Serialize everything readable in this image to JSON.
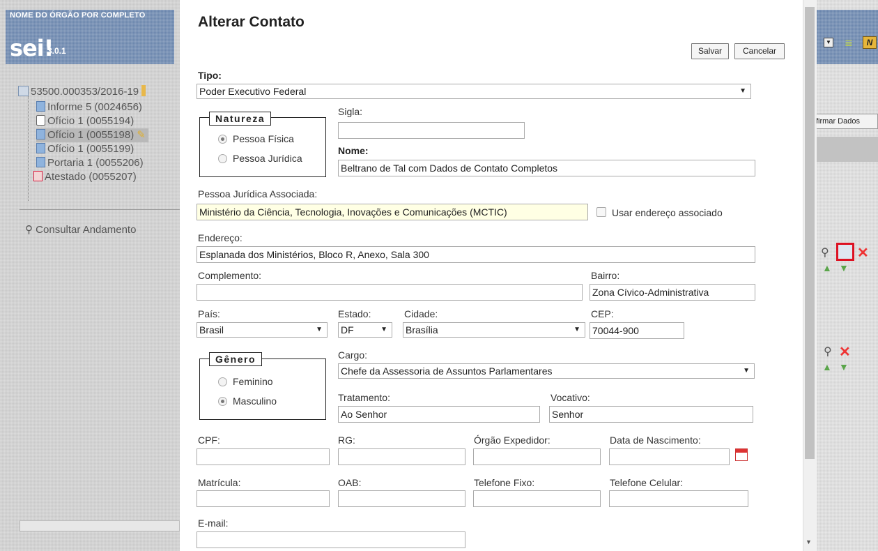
{
  "sidebar": {
    "org_name": "NOME DO ÓRGÃO POR COMPLETO",
    "logo": "sei!",
    "version": "3.0.1",
    "process_number": "53500.000353/2016-19",
    "documents": [
      {
        "label": "Informe 5 (0024656)"
      },
      {
        "label": "Ofício 1 (0055194)"
      },
      {
        "label": "Ofício 1 (0055198)"
      },
      {
        "label": "Ofício 1 (0055199)"
      },
      {
        "label": "Portaria 1 (0055206)"
      },
      {
        "label": "Atestado (0055207)"
      }
    ],
    "consultar": "Consultar Andamento"
  },
  "background": {
    "confirm_button": "firmar Dados"
  },
  "form": {
    "title": "Alterar Contato",
    "save_label": "Salvar",
    "cancel_label": "Cancelar",
    "tipo_label": "Tipo:",
    "tipo_value": "Poder Executivo Federal",
    "natureza_legend": "Natureza",
    "natureza_options": [
      "Pessoa Física",
      "Pessoa Jurídica"
    ],
    "natureza_selected": "Pessoa Física",
    "sigla_label": "Sigla:",
    "sigla_value": "",
    "nome_label": "Nome:",
    "nome_value": "Beltrano de Tal com Dados de Contato Completos",
    "pj_label": "Pessoa Jurídica Associada:",
    "pj_value": "Ministério da Ciência, Tecnologia, Inovações e Comunicações (MCTIC)",
    "usar_endereco_label": "Usar endereço associado",
    "endereco_label": "Endereço:",
    "endereco_value": "Esplanada dos Ministérios, Bloco R, Anexo, Sala 300",
    "complemento_label": "Complemento:",
    "complemento_value": "",
    "bairro_label": "Bairro:",
    "bairro_value": "Zona Cívico-Administrativa",
    "pais_label": "País:",
    "pais_value": "Brasil",
    "estado_label": "Estado:",
    "estado_value": "DF",
    "cidade_label": "Cidade:",
    "cidade_value": "Brasília",
    "cep_label": "CEP:",
    "cep_value": "70044-900",
    "genero_legend": "Gênero",
    "genero_options": [
      "Feminino",
      "Masculino"
    ],
    "genero_selected": "Masculino",
    "cargo_label": "Cargo:",
    "cargo_value": "Chefe da Assessoria de Assuntos Parlamentares",
    "tratamento_label": "Tratamento:",
    "tratamento_value": "Ao Senhor",
    "vocativo_label": "Vocativo:",
    "vocativo_value": "Senhor",
    "cpf_label": "CPF:",
    "rg_label": "RG:",
    "orgao_label": "Órgão Expedidor:",
    "nascimento_label": "Data de Nascimento:",
    "matricula_label": "Matrícula:",
    "oab_label": "OAB:",
    "tel_fixo_label": "Telefone Fixo:",
    "tel_cel_label": "Telefone Celular:",
    "email_label": "E-mail:"
  }
}
